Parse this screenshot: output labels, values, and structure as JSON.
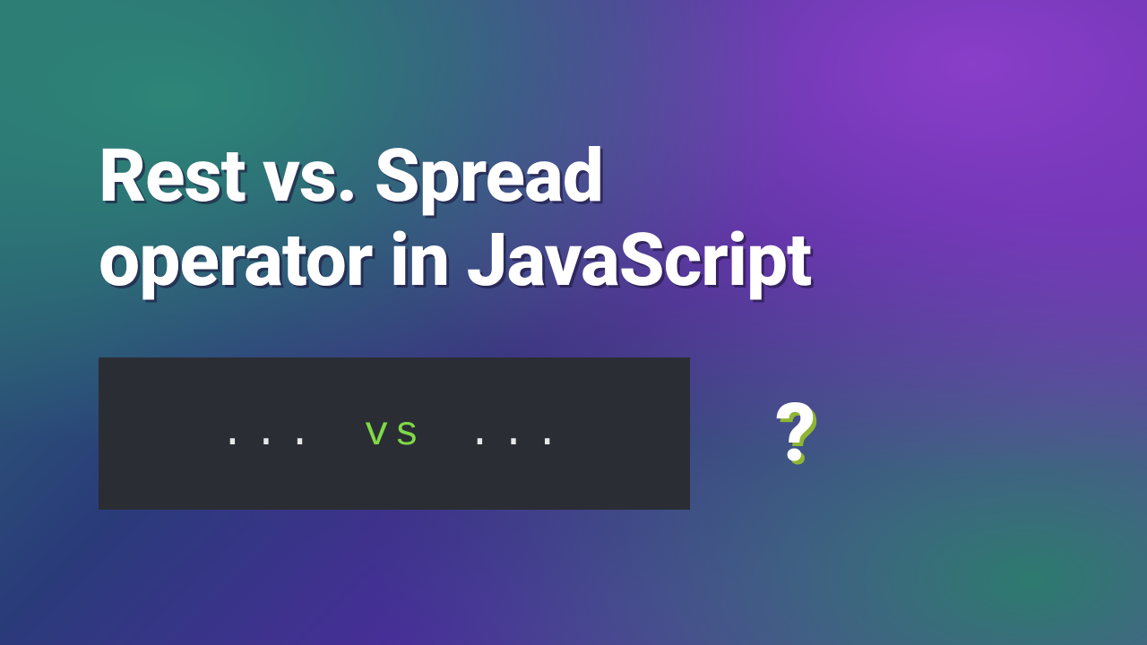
{
  "title_line1": "Rest vs. Spread",
  "title_line2": "operator in JavaScript",
  "code": {
    "left_dots": "...",
    "vs_text": "vs",
    "right_dots": "..."
  },
  "question_mark": "?"
}
